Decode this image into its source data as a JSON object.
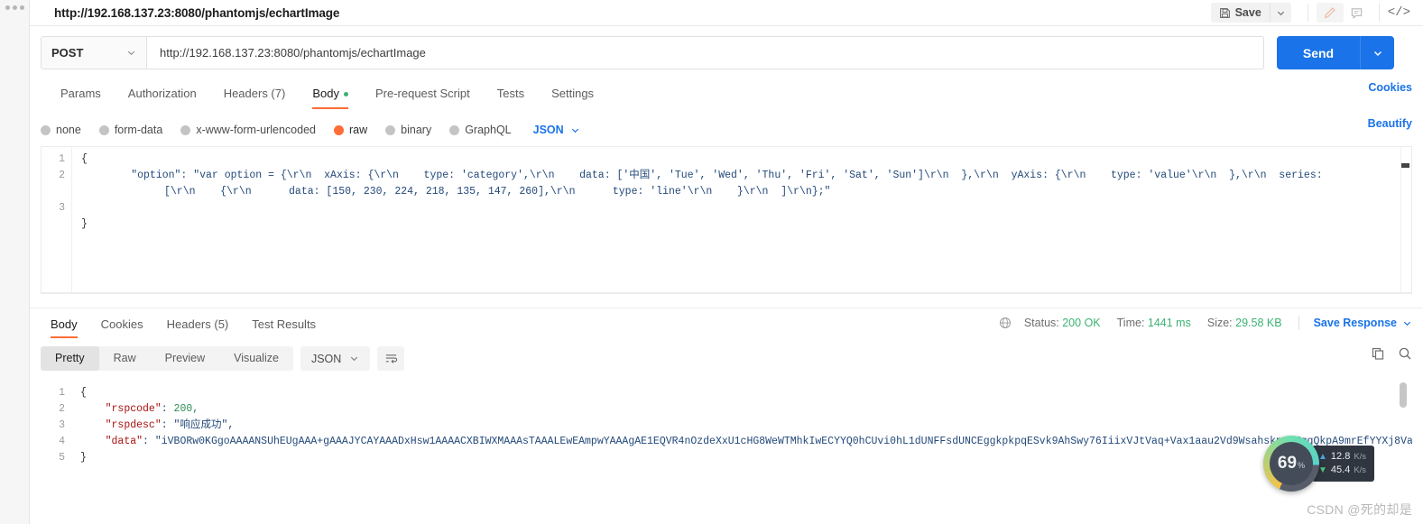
{
  "window": {
    "tab_title": "http://192.168.137.23:8080/phantomjs/echartImage"
  },
  "toolbar": {
    "save_label": "Save",
    "save_icon": "floppy-disk-icon",
    "caret_icon": "chevron-down-icon",
    "edit_icon": "pencil-icon",
    "comment_icon": "comment-icon",
    "code_icon": "</>"
  },
  "request": {
    "method": "POST",
    "url": "http://192.168.137.23:8080/phantomjs/echartImage",
    "send_label": "Send",
    "cookies_link": "Cookies",
    "beautify_link": "Beautify",
    "tabs": [
      {
        "label": "Params",
        "selected": false
      },
      {
        "label": "Authorization",
        "selected": false
      },
      {
        "label": "Headers (7)",
        "selected": false
      },
      {
        "label": "Body",
        "selected": true,
        "dot": true
      },
      {
        "label": "Pre-request Script",
        "selected": false
      },
      {
        "label": "Tests",
        "selected": false
      },
      {
        "label": "Settings",
        "selected": false
      }
    ],
    "body_types": [
      {
        "label": "none",
        "selected": false
      },
      {
        "label": "form-data",
        "selected": false
      },
      {
        "label": "x-www-form-urlencoded",
        "selected": false
      },
      {
        "label": "raw",
        "selected": true
      },
      {
        "label": "binary",
        "selected": false
      },
      {
        "label": "GraphQL",
        "selected": false
      }
    ],
    "raw_format": "JSON",
    "body_lines": [
      {
        "num": "1",
        "text": "{"
      },
      {
        "num": "2",
        "text": ""
      },
      {
        "num": "3",
        "text": "}"
      }
    ],
    "body_line2_a": "        \"option\": \"var option = {\\r\\n  xAxis: {\\r\\n    type: 'category',\\r\\n    data: ['中国', 'Tue', 'Wed', 'Thu', 'Fri', 'Sat', 'Sun']\\r\\n  },\\r\\n  yAxis: {\\r\\n    type: 'value'\\r\\n  },\\r\\n  series:",
    "body_line2_b": "[\\r\\n    {\\r\\n      data: [150, 230, 224, 218, 135, 147, 260],\\r\\n      type: 'line'\\r\\n    }\\r\\n  ]\\r\\n};\""
  },
  "response": {
    "tabs": [
      {
        "label": "Body",
        "selected": true
      },
      {
        "label": "Cookies",
        "selected": false
      },
      {
        "label": "Headers (5)",
        "selected": false
      },
      {
        "label": "Test Results",
        "selected": false
      }
    ],
    "status_label": "Status:",
    "status_value": "200 OK",
    "time_label": "Time:",
    "time_value": "1441 ms",
    "size_label": "Size:",
    "size_value": "29.58 KB",
    "save_response": "Save Response",
    "globe_icon": "globe-icon",
    "copy_icon": "copy-icon",
    "search_icon": "search-icon",
    "views": [
      {
        "label": "Pretty",
        "selected": true
      },
      {
        "label": "Raw",
        "selected": false
      },
      {
        "label": "Preview",
        "selected": false
      },
      {
        "label": "Visualize",
        "selected": false
      }
    ],
    "format": "JSON",
    "wrap_icon": "wrap-lines-icon",
    "body_lines": [
      {
        "num": "1",
        "text": "{"
      },
      {
        "num": "2",
        "key": "\"rspcode\"",
        "val": "200,"
      },
      {
        "num": "3",
        "key": "\"rspdesc\"",
        "val": "\"响应成功\","
      },
      {
        "num": "4",
        "key": "\"data\"",
        "val": "\"iVBORw0KGgoAAAANSUhEUgAAA+gAAAJYCAYAAADxHsw1AAAACXBIWXMAAAsTAAALEwEAmpwYAAAgAE1EQVR4nOzdeXxU1cHG8WeWTMhkIwECYYQ0hCUvi0hL1dUNFFsdUNCEggkpkpqESvk9AhSwy76IiixVJtVaq+Vax1aau2Vd9WsahskpAEEggQkpA9mrEfYYXj8Vaq+Vax1aau2Vd9WsahskpAEEggQkpA9mrEfYYXj"
      },
      {
        "num": "5",
        "text": "}"
      }
    ]
  },
  "net_widget": {
    "percent": "69",
    "percent_unit": "%",
    "upload": "12.8",
    "upload_unit": "K/s",
    "download": "45.4",
    "download_unit": "K/s"
  },
  "watermark": "CSDN @死的却是"
}
